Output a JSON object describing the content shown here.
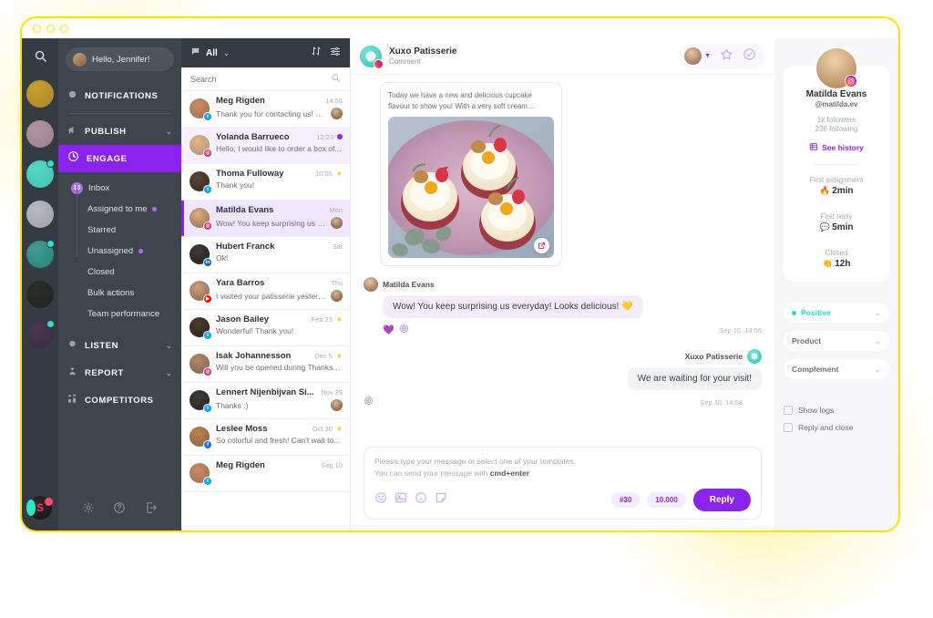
{
  "window": {
    "dots": 3
  },
  "rail": {
    "search_icon": "search-icon",
    "brands": [
      {
        "name": "brand-gold-leaf",
        "color1": "#c8a02e",
        "color2": "#a8862a",
        "dot": false
      },
      {
        "name": "brand-mauve-tree",
        "color1": "#b094a0",
        "color2": "#9c8090",
        "dot": false
      },
      {
        "name": "brand-xuxo-patisserie",
        "color1": "#56d6c6",
        "color2": "#3fc4b2",
        "dot": true,
        "active": true
      },
      {
        "name": "brand-grey-paint",
        "color1": "#b8bcc0",
        "color2": "#9ca1a6",
        "dot": false
      },
      {
        "name": "brand-bicycle",
        "color1": "#3f9c93",
        "color2": "#2e8078",
        "dot": true
      },
      {
        "name": "brand-dark-diamond",
        "color1": "#2a2f28",
        "color2": "#1f2420",
        "dot": false
      },
      {
        "name": "brand-colored-ring",
        "color1": "#4a3a52",
        "color2": "#362a3e",
        "dot": true
      }
    ],
    "bottom_logo": "company-logo-s"
  },
  "nav": {
    "greeting": "Hello, Jennifer!",
    "sections": [
      {
        "key": "notifications",
        "label": "NOTIFICATIONS",
        "icon": "bell-icon",
        "chevron": false,
        "active": false
      },
      {
        "key": "publish",
        "label": "PUBLISH",
        "icon": "megaphone-icon",
        "chevron": true,
        "active": false
      },
      {
        "key": "engage",
        "label": "ENGAGE",
        "icon": "chat-circle-icon",
        "chevron": false,
        "active": true
      }
    ],
    "engage_items": [
      {
        "label": "Inbox",
        "badge": "10",
        "dot": false,
        "child": false
      },
      {
        "label": "Assigned to me",
        "badge": "",
        "dot": true,
        "child": true
      },
      {
        "label": "Starred",
        "badge": "",
        "dot": false,
        "child": true
      },
      {
        "label": "Unassigned",
        "badge": "",
        "dot": true,
        "child": true
      },
      {
        "label": "Closed",
        "badge": "",
        "dot": false,
        "child": true
      },
      {
        "label": "Bulk actions",
        "badge": "",
        "dot": false,
        "child": true
      },
      {
        "label": "Team performance",
        "badge": "",
        "dot": false,
        "child": true
      }
    ],
    "sections_bottom": [
      {
        "key": "listen",
        "label": "LISTEN",
        "icon": "ear-icon",
        "chevron": true
      },
      {
        "key": "report",
        "label": "REPORT",
        "icon": "chart-icon",
        "chevron": true
      },
      {
        "key": "competitors",
        "label": "COMPETITORS",
        "icon": "grid-icon",
        "chevron": false
      }
    ],
    "footer_icons": [
      "gear-icon",
      "help-icon",
      "logout-icon"
    ]
  },
  "list": {
    "filter_label": "All",
    "filter_icon": "chat-bubble-icon",
    "sort_icon": "sort-icon",
    "filter_settings_icon": "sliders-icon",
    "search_placeholder": "Search",
    "search_value": "",
    "search_icon": "search-icon",
    "conversations": [
      {
        "name": "Meg Rigden",
        "preview": "Thank you for contacting us! We...",
        "time": "14:56",
        "channel": "twitter",
        "star": false,
        "unread_dot": false,
        "assignee": true,
        "state": "normal",
        "av1": "#c98f6a",
        "av2": "#9c6a4a"
      },
      {
        "name": "Yolanda Barrueco",
        "preview": "Hello, I would like to order a box of...",
        "time": "12:23",
        "channel": "instagram",
        "star": false,
        "unread_dot": true,
        "assignee": false,
        "state": "unread",
        "av1": "#e0b895",
        "av2": "#b98a63"
      },
      {
        "name": "Thoma Fulloway",
        "preview": "Thank you!",
        "time": "10:05",
        "channel": "twitter",
        "star": true,
        "unread_dot": false,
        "assignee": false,
        "state": "normal",
        "av1": "#5b4436",
        "av2": "#382a21"
      },
      {
        "name": "Matilda Evans",
        "preview": "Wow! You keep surprising us eve...",
        "time": "Mon",
        "channel": "instagram",
        "star": false,
        "unread_dot": false,
        "assignee": true,
        "state": "selected",
        "av1": "#d9b088",
        "av2": "#8d6a4c"
      },
      {
        "name": "Hubert Franck",
        "preview": "Ok!",
        "time": "Sat",
        "channel": "linkedin",
        "star": false,
        "unread_dot": false,
        "assignee": false,
        "state": "normal",
        "av1": "#3d3a38",
        "av2": "#232120"
      },
      {
        "name": "Yara Barros",
        "preview": "I visited your patisserie yesterday...",
        "time": "Thu",
        "channel": "youtube",
        "star": false,
        "unread_dot": false,
        "assignee": true,
        "state": "normal",
        "av1": "#caa083",
        "av2": "#8a6248"
      },
      {
        "name": "Jason Bailey",
        "preview": "Wonderful! Thank you!",
        "time": "Feb 23",
        "channel": "twitter",
        "star": true,
        "unread_dot": false,
        "assignee": false,
        "state": "normal",
        "av1": "#4d3a2d",
        "av2": "#2b211a"
      },
      {
        "name": "Isak Johannesson",
        "preview": "Will you be opened during Thanksgi...",
        "time": "Dec 5",
        "channel": "instagram",
        "star": true,
        "unread_dot": false,
        "assignee": false,
        "state": "normal",
        "av1": "#b08a6c",
        "av2": "#7d6049"
      },
      {
        "name": "Lennert Nijenbijvan Si...",
        "preview": "Thanks :)",
        "time": "Nov 29",
        "channel": "twitter",
        "star": false,
        "unread_dot": false,
        "assignee": true,
        "state": "normal",
        "av1": "#3f3a36",
        "av2": "#272320"
      },
      {
        "name": "Leslee Moss",
        "preview": "So colorful and fresh! Can't wait to...",
        "time": "Oct 30",
        "channel": "facebook",
        "star": true,
        "unread_dot": false,
        "assignee": false,
        "state": "normal",
        "av1": "#b9854f",
        "av2": "#8a6038"
      },
      {
        "name": "Meg Rigden",
        "preview": "",
        "time": "Sep 10",
        "channel": "twitter",
        "star": false,
        "unread_dot": false,
        "assignee": false,
        "state": "normal",
        "av1": "#c98f6a",
        "av2": "#9c6a4a"
      }
    ]
  },
  "conversation": {
    "header": {
      "account_name": "Xuxo Patisserie",
      "type_label": "Comment",
      "channel": "instagram",
      "star_icon": "star-icon",
      "resolve_icon": "check-circle-icon",
      "assignee_chevron": "chevron-down-icon"
    },
    "post": {
      "text": "Today we have a new and delicious cupcake flavour to show you! With a very soft cream...",
      "image_alt": "three-cupcakes-on-lilac-plate",
      "open_icon": "external-link-icon"
    },
    "messages": [
      {
        "direction": "in",
        "author": "Matilda Evans",
        "text": "Wow! You keep surprising us everyday! Looks delicious! 💛",
        "timestamp": "Sep 10, 14:56",
        "reactions": [
          "💜",
          "instagram-like-icon"
        ]
      },
      {
        "direction": "out",
        "author": "Xuxo Patisserie",
        "text": "We are waiting for your visit!",
        "timestamp": "Sep 10, 14:58",
        "reactions": [
          "instagram-like-icon"
        ]
      }
    ],
    "composer": {
      "placeholder_line1": "Please type your message or select one of your templates.",
      "placeholder_line2_pre": "You can send your message with ",
      "placeholder_line2_bold": "cmd+enter",
      "value": "",
      "tools": [
        "emoji-icon",
        "image-icon",
        "gif-icon",
        "template-icon"
      ],
      "chip_hashtag": "#30",
      "chip_count": "10.000",
      "reply_label": "Reply"
    }
  },
  "right_panel": {
    "profile": {
      "name": "Matilda Evans",
      "handle": "@matilda.ev",
      "followers": "1k followers",
      "following": "236 following",
      "network": "instagram",
      "see_history_label": "See history",
      "see_history_icon": "history-icon"
    },
    "metrics": [
      {
        "label": "First assignment",
        "emoji": "🔥",
        "value": "2min"
      },
      {
        "label": "First reply",
        "emoji": "💬",
        "value": "5min"
      },
      {
        "label": "Closed",
        "emoji": "👏",
        "value": "12h"
      }
    ],
    "selects": [
      {
        "name": "sentiment-select",
        "label": "Positive",
        "dot": true,
        "accent": "#2dd4bf"
      },
      {
        "name": "category-select",
        "label": "Product",
        "dot": false,
        "accent": ""
      },
      {
        "name": "tag-select",
        "label": "Complement",
        "dot": false,
        "accent": ""
      }
    ],
    "checkboxes": [
      {
        "name": "show-logs-checkbox",
        "label": "Show logs",
        "checked": false
      },
      {
        "name": "reply-and-close-checkbox",
        "label": "Reply and close",
        "checked": false
      }
    ]
  },
  "colors": {
    "accent_purple": "#8b23ef",
    "frame_yellow": "#FFE100",
    "sidebar_dark": "#343b42",
    "nav_dark": "#3e454d",
    "teal": "#2dd4bf"
  }
}
